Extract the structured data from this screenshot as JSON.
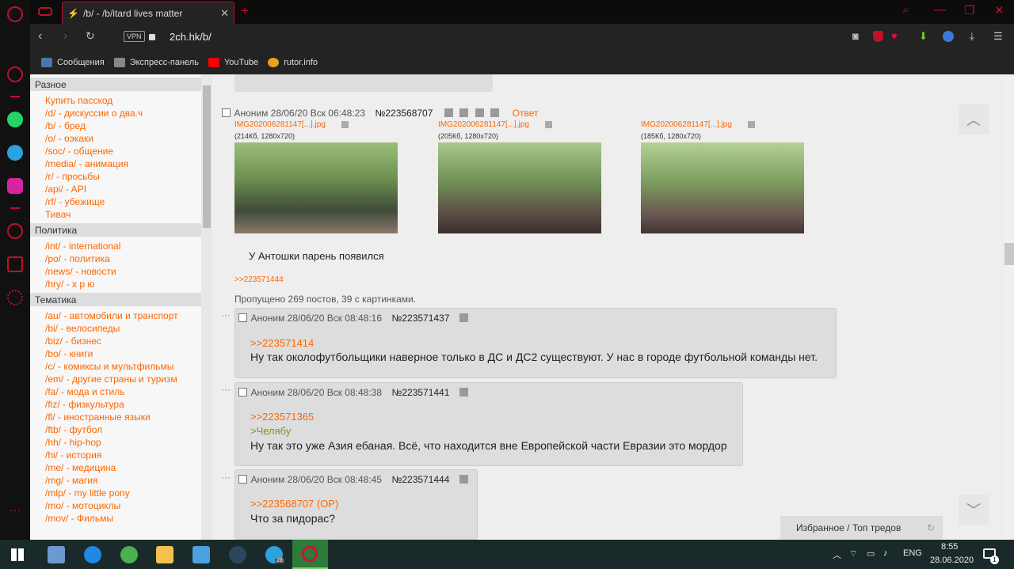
{
  "browser": {
    "tab_title": "/b/ - /b/itard lives matter",
    "vpn": "VPN",
    "url": "2ch.hk/b/"
  },
  "bookmarks": [
    {
      "label": "Сообщения",
      "icon": "messenger-icon",
      "color": "#4a76a8"
    },
    {
      "label": "Экспресс-панель",
      "icon": "grid-icon",
      "color": "#888888"
    },
    {
      "label": "YouTube",
      "icon": "youtube-icon",
      "color": "#ff0000"
    },
    {
      "label": "rutor.info",
      "icon": "rutor-icon",
      "color": "#e8a020"
    }
  ],
  "sidebar": {
    "sections": [
      {
        "title": "Разное",
        "items": [
          "Купить пасскод",
          "/d/ - дискуссии о два.ч",
          "/b/ - бред",
          "/o/ - оэкаки",
          "/soc/ - общение",
          "/media/ - анимация",
          "/r/ - просьбы",
          "/api/ - API",
          "/rf/ - убежище",
          "Тивач"
        ]
      },
      {
        "title": "Политика",
        "items": [
          "/int/ - international",
          "/po/ - политика",
          "/news/ - новости",
          "/hry/ - х р ю"
        ]
      },
      {
        "title": "Тематика",
        "items": [
          "/au/ - автомобили и транспорт",
          "/bi/ - велосипеды",
          "/biz/ - бизнес",
          "/bo/ - книги",
          "/c/ - комиксы и мультфильмы",
          "/em/ - другие страны и туризм",
          "/fa/ - мода и стиль",
          "/fiz/ - физкультура",
          "/fl/ - иностранные языки",
          "/ftb/ - футбол",
          "/hh/ - hip-hop",
          "/hi/ - история",
          "/me/ - медицина",
          "/mg/ - магия",
          "/mlp/ - my little pony",
          "/mo/ - мотоциклы",
          "/mov/ - Фильмы"
        ]
      }
    ]
  },
  "op": {
    "header": "Аноним 28/06/20 Вск 06:48:23",
    "num": "№223568707",
    "reply_label": "Ответ",
    "images": [
      {
        "name": "IMG202006281147[...].jpg",
        "meta": "(214Кб, 1280x720)"
      },
      {
        "name": "IMG202006281147[...].jpg",
        "meta": "(205Кб, 1280x720)"
      },
      {
        "name": "IMG202006281147[...].jpg",
        "meta": "(185Кб, 1280x720)"
      }
    ],
    "text": "У Антошки парень появился",
    "backref": ">>223571444",
    "omitted": "Пропущено 269 постов, 39 с картинками."
  },
  "replies": [
    {
      "header": "Аноним 28/06/20 Вск 08:48:16",
      "num": "№223571437",
      "quote": ">>223571414",
      "green": "",
      "text": "Ну так околофутбольщики наверное только в ДС и ДС2 существуют. У нас в городе футбольной команды нет."
    },
    {
      "header": "Аноним 28/06/20 Вск 08:48:38",
      "num": "№223571441",
      "quote": ">>223571365",
      "green": ">Челябу",
      "text": "Ну так это уже Азия ебаная. Всё, что находится вне Европейской части Евразии это мордор"
    },
    {
      "header": "Аноним 28/06/20 Вск 08:48:45",
      "num": "№223571444",
      "quote": ">>223568707 (OP)",
      "green": "",
      "text": "Что за пидорас?"
    }
  ],
  "favorites": "Избранное / Топ тредов",
  "taskbar": {
    "lang": "ENG",
    "time": "8:55",
    "date": "28.06.2020",
    "badge": "28",
    "notify": "1"
  }
}
